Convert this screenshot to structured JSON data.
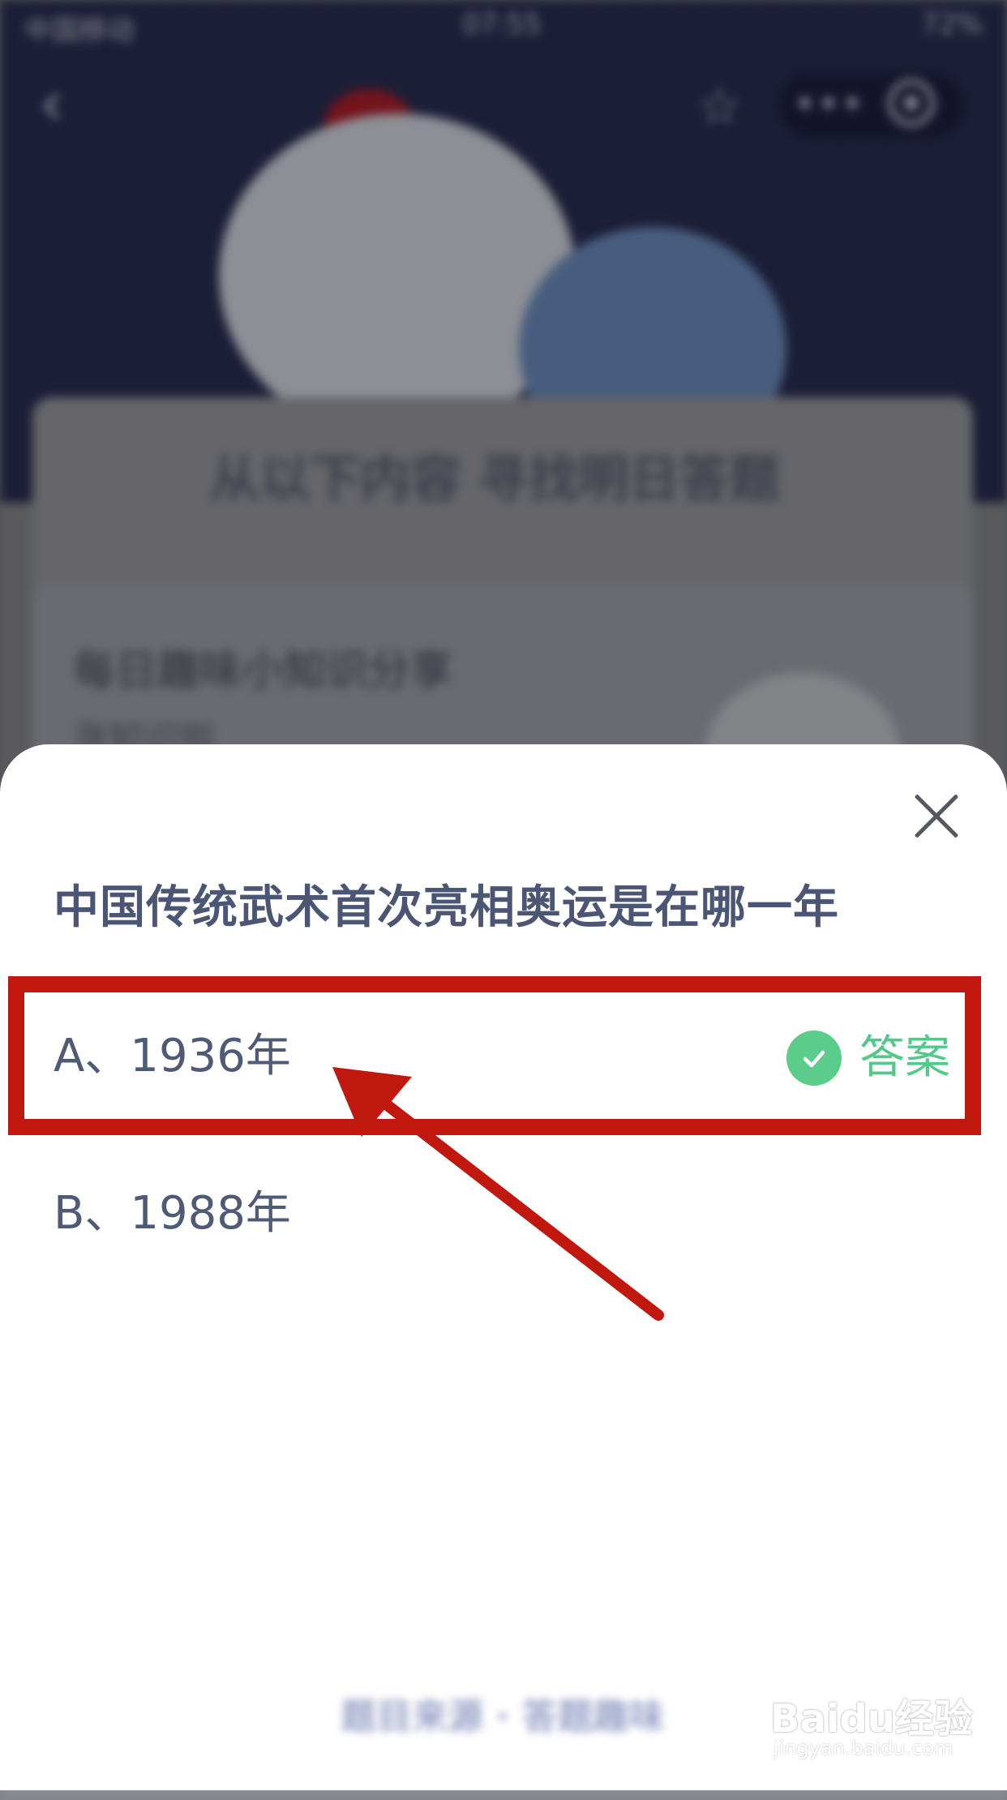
{
  "status_bar": {
    "carrier": "中国移动",
    "time": "07:55",
    "battery": "72%"
  },
  "background": {
    "banner_title": "从以下内容 寻找明日答题",
    "card_title": "每日趣味小知识分享",
    "card_subtitle": "涨知识啦"
  },
  "sheet": {
    "question": "中国传统武术首次亮相奥运是在哪一年",
    "options": [
      {
        "label": "A、1936年",
        "is_answer": true,
        "answer_label": "答案"
      },
      {
        "label": "B、1988年",
        "is_answer": false
      }
    ],
    "footer_button": "题目来源 · 答题趣味"
  },
  "watermark": {
    "logo": "Baidu经验",
    "url": "jingyan.baidu.com"
  },
  "colors": {
    "accent_green": "#54c88a",
    "highlight_red": "#c0180f",
    "question_text": "#4b5674"
  }
}
